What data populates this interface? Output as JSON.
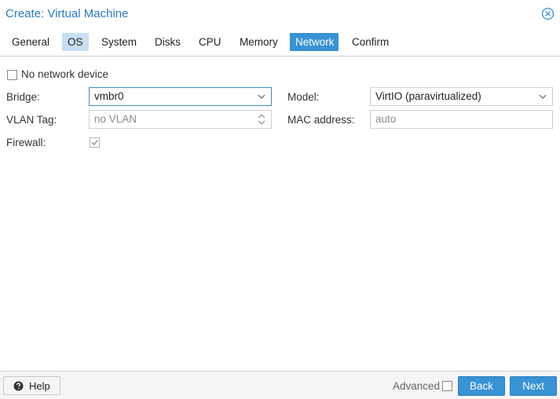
{
  "window": {
    "title": "Create: Virtual Machine",
    "close_icon": "close-circle-icon"
  },
  "tabs": [
    {
      "label": "General",
      "state": "normal"
    },
    {
      "label": "OS",
      "state": "highlighted"
    },
    {
      "label": "System",
      "state": "normal"
    },
    {
      "label": "Disks",
      "state": "normal"
    },
    {
      "label": "CPU",
      "state": "normal"
    },
    {
      "label": "Memory",
      "state": "normal"
    },
    {
      "label": "Network",
      "state": "active"
    },
    {
      "label": "Confirm",
      "state": "normal"
    }
  ],
  "form": {
    "no_network_device": {
      "label": "No network device",
      "checked": false
    },
    "bridge": {
      "label": "Bridge:",
      "value": "vmbr0"
    },
    "vlan_tag": {
      "label": "VLAN Tag:",
      "placeholder": "no VLAN"
    },
    "firewall": {
      "label": "Firewall:",
      "checked": true
    },
    "model": {
      "label": "Model:",
      "value": "VirtIO (paravirtualized)"
    },
    "mac_address": {
      "label": "MAC address:",
      "placeholder": "auto"
    }
  },
  "footer": {
    "help_label": "Help",
    "advanced_label": "Advanced",
    "advanced_checked": false,
    "back_label": "Back",
    "next_label": "Next"
  },
  "colors": {
    "accent": "#3892d4",
    "title": "#2a7ac2",
    "highlight_tab": "#c7def4",
    "footer_bg": "#f5f5f5"
  }
}
